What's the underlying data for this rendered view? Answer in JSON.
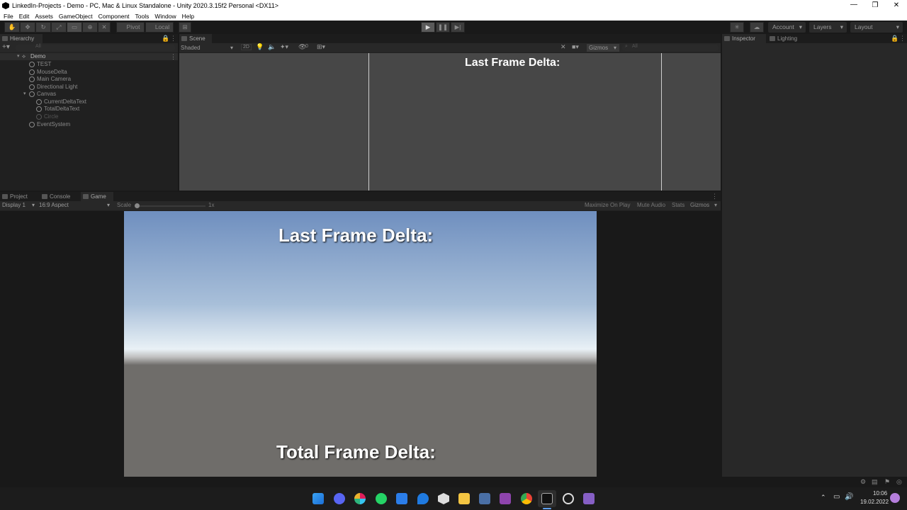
{
  "window": {
    "title": "LinkedIn-Projects - Demo - PC, Mac & Linux Standalone - Unity 2020.3.15f2 Personal <DX11>",
    "minimize": "—",
    "maximize": "❐",
    "close": "✕"
  },
  "menu": [
    "File",
    "Edit",
    "Assets",
    "GameObject",
    "Component",
    "Tools",
    "Window",
    "Help"
  ],
  "toolbar": {
    "pivot": "Pivot",
    "local": "Local",
    "account": "Account",
    "layers": "Layers",
    "layout": "Layout"
  },
  "hierarchy": {
    "tab": "Hierarchy",
    "search_placeholder": "All",
    "scene": "Demo",
    "items": [
      "TEST",
      "MouseDelta",
      "Main Camera",
      "Directional Light",
      "Canvas",
      "CurrentDeltaText",
      "TotalDeltaText",
      "Circle",
      "EventSystem"
    ]
  },
  "scene": {
    "tab": "Scene",
    "shading": "Shaded",
    "toggle_2d": "2D",
    "gizmos": "Gizmos",
    "search_placeholder": "All",
    "hidden_count": "0",
    "overlay_text": "Last Frame Delta:"
  },
  "inspector": {
    "tab": "Inspector",
    "lighting_tab": "Lighting"
  },
  "bottom_tabs": {
    "project": "Project",
    "console": "Console",
    "game": "Game"
  },
  "game": {
    "display": "Display 1",
    "aspect": "16:9 Aspect",
    "scale_label": "Scale",
    "scale_value": "1x",
    "maximize": "Maximize On Play",
    "mute": "Mute Audio",
    "stats": "Stats",
    "gizmos": "Gizmos",
    "top_text": "Last Frame Delta:",
    "bottom_text": "Total Frame Delta:"
  },
  "taskbar": {
    "time": "10:06",
    "date": "19.02.2022"
  },
  "colors": {
    "accent_play": "#5a5a5a",
    "sky_top": "#6f8fbf",
    "sky_horizon": "#e9f1f6",
    "ground": "#6f6d6a"
  }
}
